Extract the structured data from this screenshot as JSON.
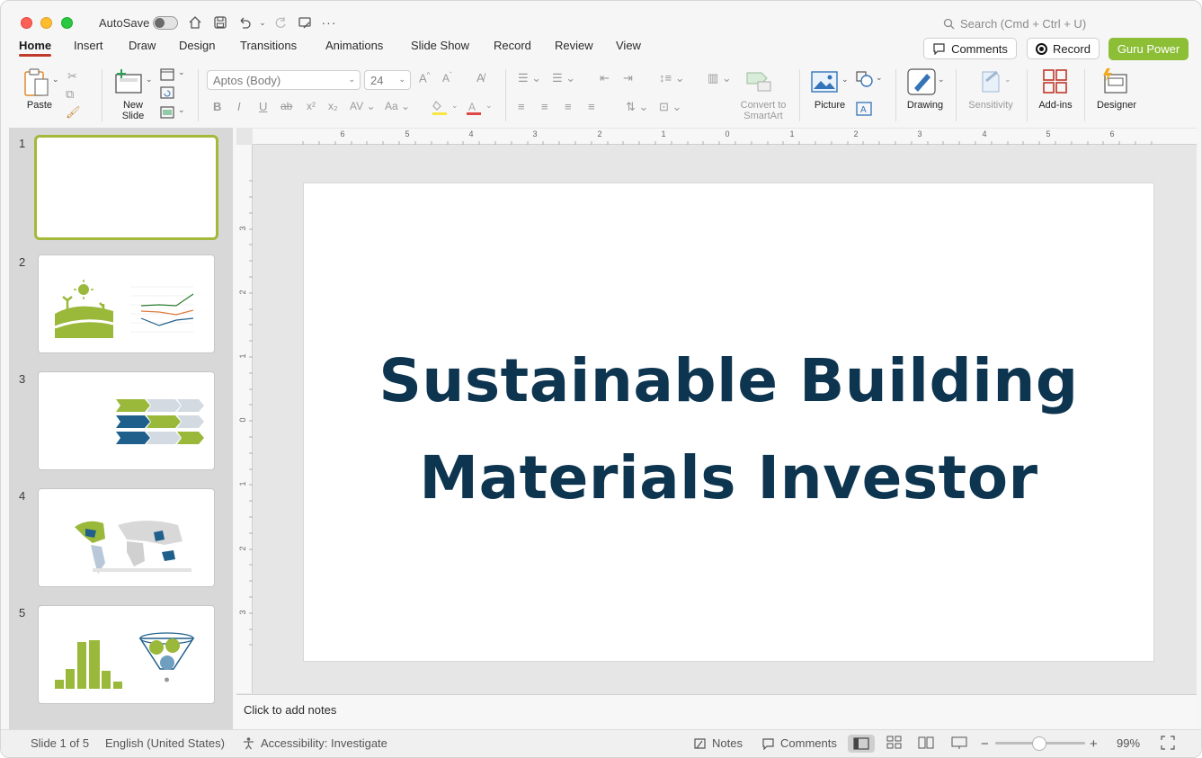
{
  "titlebar": {
    "autosave_label": "AutoSave",
    "search_placeholder": "Search (Cmd + Ctrl + U)"
  },
  "tabs": [
    "Home",
    "Insert",
    "Draw",
    "Design",
    "Transitions",
    "Animations",
    "Slide Show",
    "Record",
    "Review",
    "View"
  ],
  "actions": {
    "comments": "Comments",
    "record": "Record",
    "guru": "Guru Power",
    "guru_color": "#8cbe36"
  },
  "ribbon": {
    "paste": "Paste",
    "new_slide_1": "New",
    "new_slide_2": "Slide",
    "font_name": "Aptos (Body)",
    "font_size": "24",
    "convert_1": "Convert to",
    "convert_2": "SmartArt",
    "picture": "Picture",
    "drawing": "Drawing",
    "sensitivity": "Sensitivity",
    "addins": "Add-ins",
    "designer": "Designer"
  },
  "slides": [
    {
      "number": "1"
    },
    {
      "number": "2"
    },
    {
      "number": "3"
    },
    {
      "number": "4"
    },
    {
      "number": "5"
    }
  ],
  "slide": {
    "title_line1": "Sustainable Building",
    "title_line2": "Materials Investor",
    "title_color": "#0d3550"
  },
  "notes": {
    "placeholder": "Click to add notes"
  },
  "status": {
    "slide_info": "Slide 1 of 5",
    "language": "English (United States)",
    "accessibility": "Accessibility: Investigate",
    "notes": "Notes",
    "comments": "Comments",
    "zoom": "99%"
  }
}
